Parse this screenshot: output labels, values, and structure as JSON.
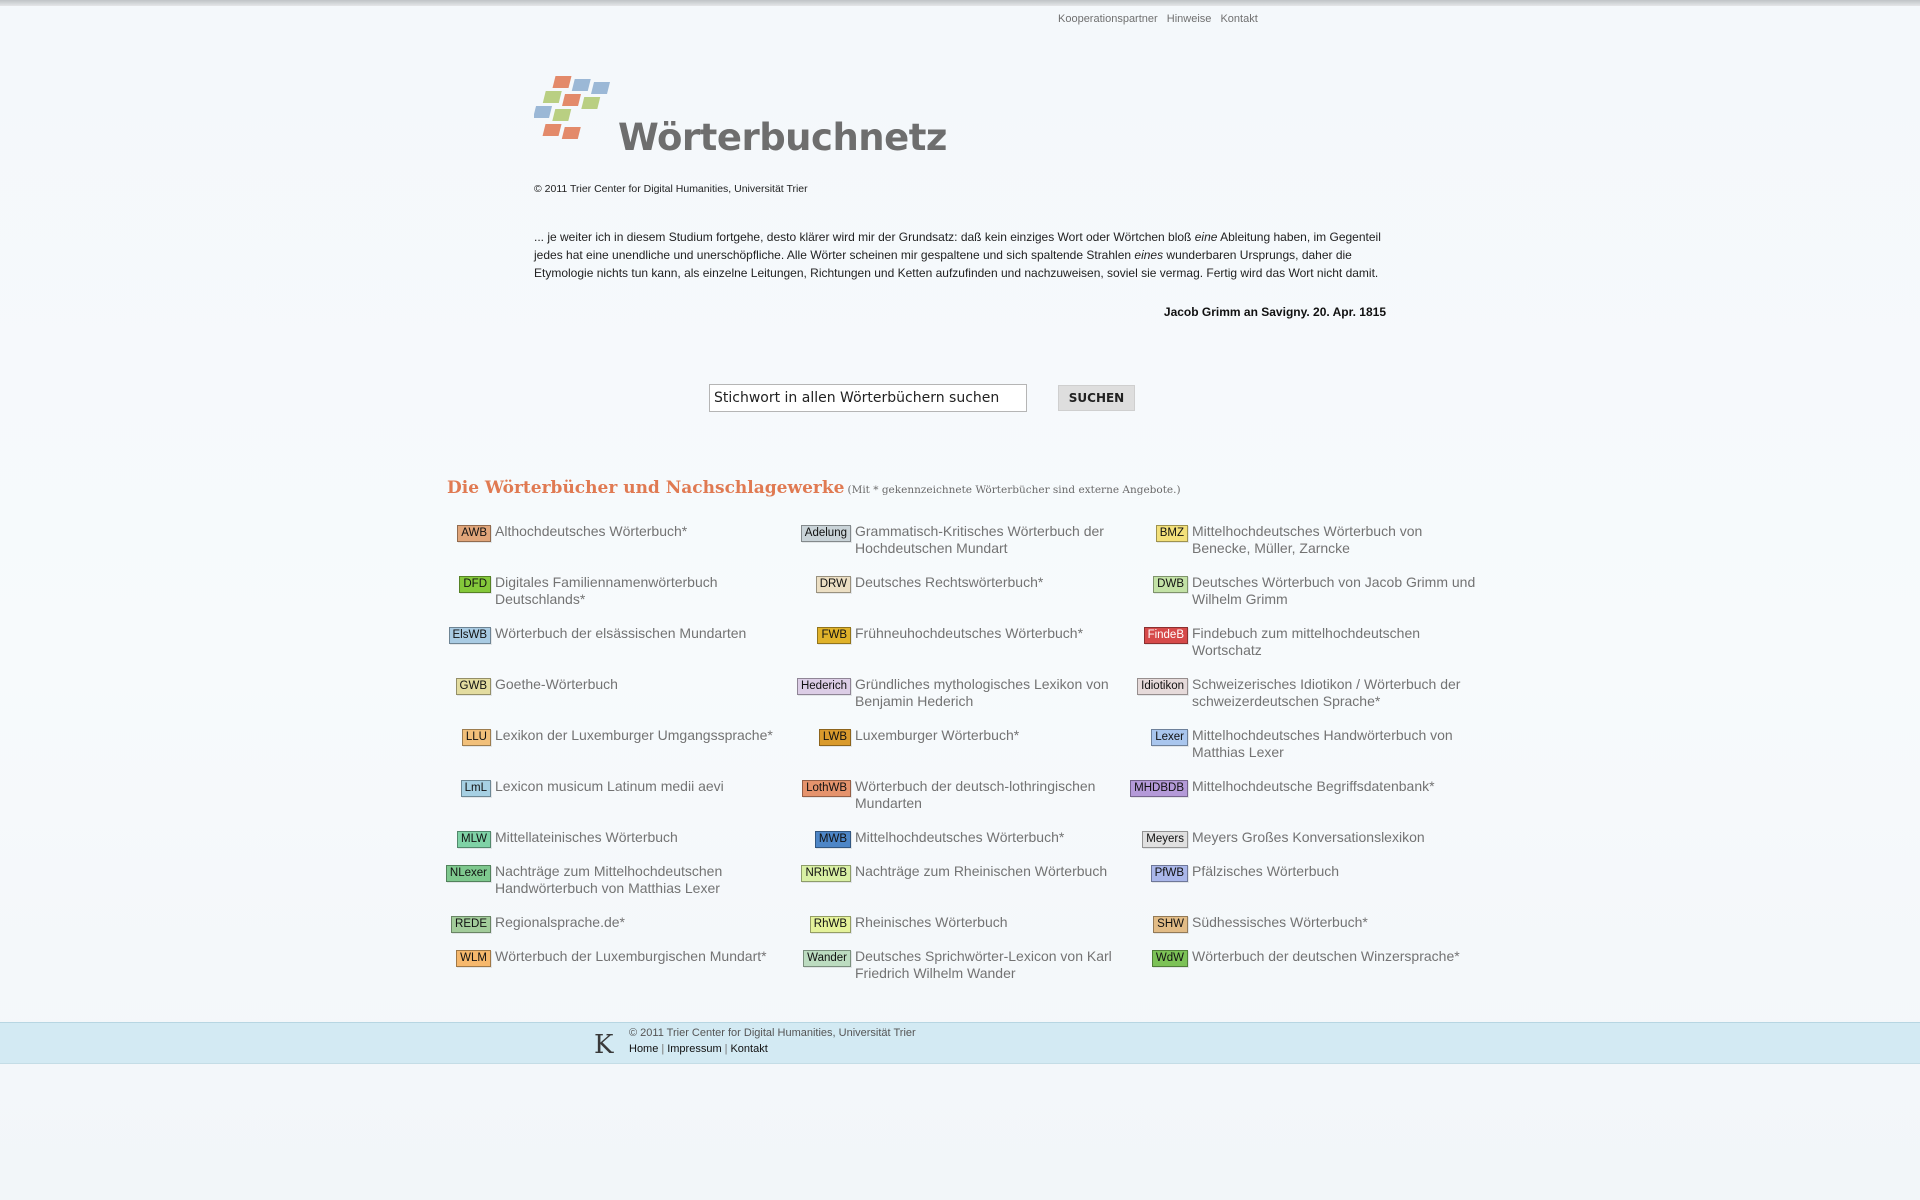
{
  "top_links": [
    "Kooperationspartner",
    "Hinweise",
    "Kontakt"
  ],
  "brand": {
    "name": "Wörterbuchnetz",
    "copyright": "© 2011 Trier Center for Digital Humanities, Universität Trier"
  },
  "quote": {
    "p1": "... je weiter ich in diesem Studium fortgehe, desto klärer wird mir der Grundsatz: daß kein einziges Wort oder Wörtchen bloß ",
    "em1": "eine",
    "p2": " Ableitung haben, im Gegenteil jedes hat eine unendliche und unerschöpfliche. Alle Wörter scheinen mir gespaltene und sich spaltende Strahlen ",
    "em2": "eines",
    "p3": " wunderbaren Ursprungs, daher die Etymologie nichts tun kann, als einzelne Leitungen, Richtungen und Ketten aufzufinden und nachzuweisen, soviel sie vermag. Fertig wird das Wort nicht damit.",
    "source": "Jacob Grimm an Savigny. 20. Apr. 1815"
  },
  "search": {
    "placeholder": "Stichwort in allen Wörterbüchern suchen",
    "button": "SUCHEN"
  },
  "dictionaries": {
    "title": "Die Wörterbücher und Nachschlagewerke",
    "note": "(Mit * gekennzeichnete Wörterbücher sind externe Angebote.)",
    "items": [
      {
        "abbr": "AWB",
        "title": "Althochdeutsches Wörterbuch*",
        "color": "#e0a57a"
      },
      {
        "abbr": "Adelung",
        "title": "Grammatisch-Kritisches Wörterbuch der Hochdeutschen Mundart",
        "color": "#c9d3d8"
      },
      {
        "abbr": "BMZ",
        "title": "Mittelhochdeutsches Wörterbuch von Benecke, Müller, Zarncke",
        "color": "#f3e07a"
      },
      {
        "abbr": "DFD",
        "title": "Digitales Familiennamenwörterbuch Deutschlands*",
        "color": "#84c83a"
      },
      {
        "abbr": "DRW",
        "title": "Deutsches Rechtswörterbuch*",
        "color": "#ecdfc4"
      },
      {
        "abbr": "DWB",
        "title": "Deutsches Wörterbuch von Jacob Grimm und Wilhelm Grimm",
        "color": "#c3e2a6"
      },
      {
        "abbr": "ElsWB",
        "title": "Wörterbuch der elsässischen Mundarten",
        "color": "#a9cbe3"
      },
      {
        "abbr": "FWB",
        "title": "Frühneuhochdeutsches Wörterbuch*",
        "color": "#e0b22a"
      },
      {
        "abbr": "FindeB",
        "title": "Findebuch zum mittelhochdeutschen Wortschatz",
        "color": "#d64a4a"
      },
      {
        "abbr": "GWB",
        "title": "Goethe-Wörterbuch",
        "color": "#e3dca0"
      },
      {
        "abbr": "Hederich",
        "title": "Gründliches mythologisches Lexikon von Benjamin Hederich",
        "color": "#dccde6"
      },
      {
        "abbr": "Idiotikon",
        "title": "Schweizerisches Idiotikon / Wörterbuch der schweizerdeutschen Sprache*",
        "color": "#e6dada"
      },
      {
        "abbr": "LLU",
        "title": "Lexikon der Luxemburger Umgangssprache*",
        "color": "#f2c07a"
      },
      {
        "abbr": "LWB",
        "title": "Luxemburger Wörterbuch*",
        "color": "#d99a2c"
      },
      {
        "abbr": "Lexer",
        "title": "Mittelhochdeutsches Handwörterbuch von Matthias Lexer",
        "color": "#a9c6ee"
      },
      {
        "abbr": "LmL",
        "title": "Lexicon musicum Latinum medii aevi",
        "color": "#a6d0e3"
      },
      {
        "abbr": "LothWB",
        "title": "Wörterbuch der deutsch-lothringischen Mundarten",
        "color": "#e5936c"
      },
      {
        "abbr": "MHDBDB",
        "title": "Mittelhochdeutsche Begriffsdatenbank*",
        "color": "#b49ad8"
      },
      {
        "abbr": "MLW",
        "title": "Mittellateinisches Wörterbuch",
        "color": "#7fd2a6"
      },
      {
        "abbr": "MWB",
        "title": "Mittelhochdeutsches Wörterbuch*",
        "color": "#4d86c7"
      },
      {
        "abbr": "Meyers",
        "title": "Meyers Großes Konversationslexikon",
        "color": "#e0e0e0"
      },
      {
        "abbr": "NLexer",
        "title": "Nachträge zum Mittelhochdeutschen Handwörterbuch von Matthias Lexer",
        "color": "#7ec88e"
      },
      {
        "abbr": "NRhWB",
        "title": "Nachträge zum Rheinischen Wörterbuch",
        "color": "#d9f0a4"
      },
      {
        "abbr": "PfWB",
        "title": "Pfälzisches Wörterbuch",
        "color": "#aab7ea"
      },
      {
        "abbr": "REDE",
        "title": "Regionalsprache.de*",
        "color": "#a2cc9a"
      },
      {
        "abbr": "RhWB",
        "title": "Rheinisches Wörterbuch",
        "color": "#e4f29a"
      },
      {
        "abbr": "SHW",
        "title": "Südhessisches Wörterbuch*",
        "color": "#e2bc86"
      },
      {
        "abbr": "WLM",
        "title": "Wörterbuch der Luxemburgischen Mundart*",
        "color": "#f6b86c"
      },
      {
        "abbr": "Wander",
        "title": "Deutsches Sprichwörter-Lexicon von Karl Friedrich Wilhelm Wander",
        "color": "#bcdcc0"
      },
      {
        "abbr": "WdW",
        "title": "Wörterbuch der deutschen Winzersprache*",
        "color": "#7cc256"
      }
    ]
  },
  "footer": {
    "logo_glyph": "K",
    "copyright": "© 2011 Trier Center for Digital Humanities, Universität Trier",
    "links": [
      "Home",
      "Impressum",
      "Kontakt"
    ]
  }
}
